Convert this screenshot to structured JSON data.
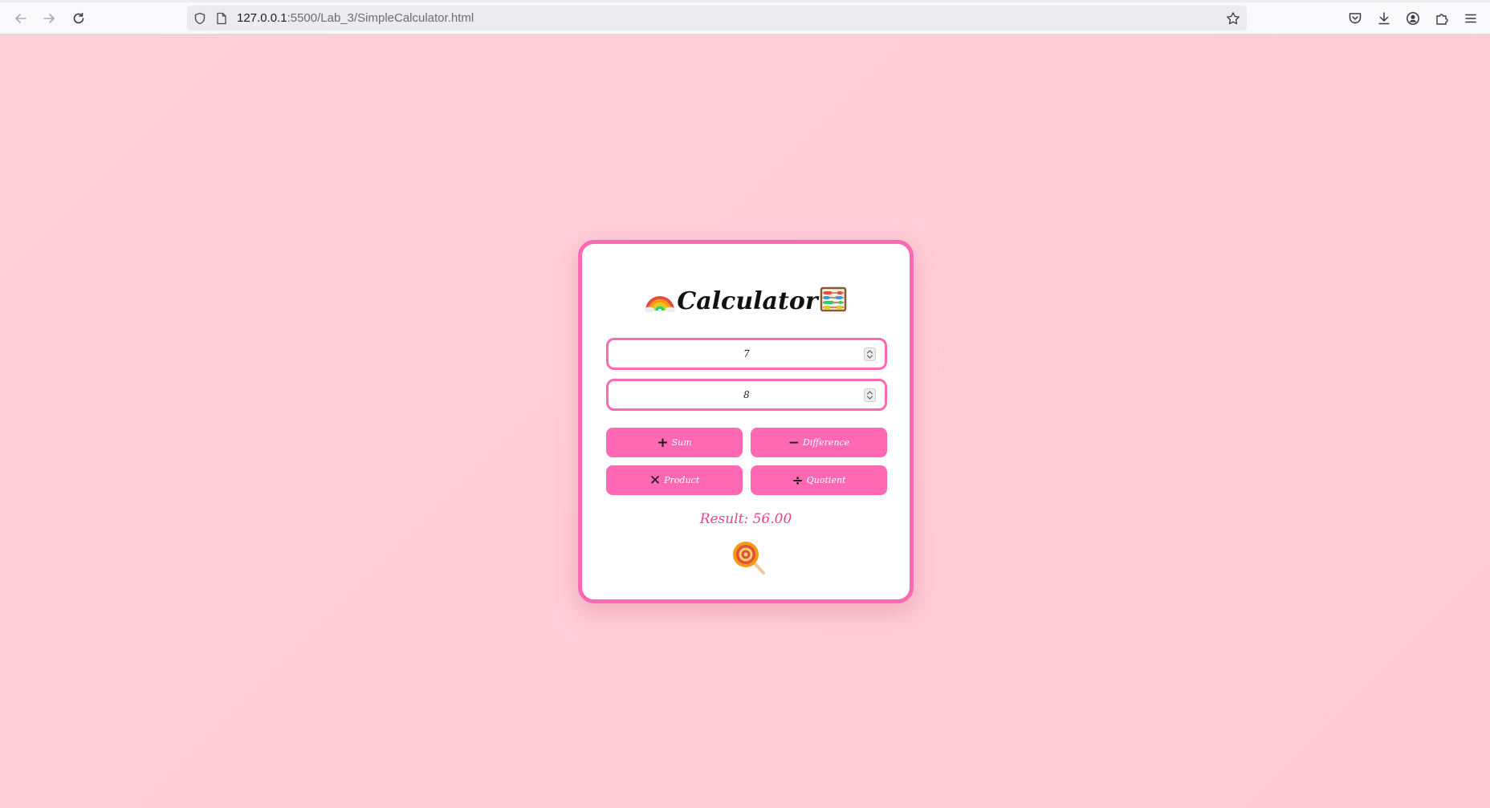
{
  "browser": {
    "url_host": "127.0.0.1",
    "url_rest": ":5500/Lab_3/SimpleCalculator.html"
  },
  "calculator": {
    "title": "Calculator",
    "title_left_icon": "rainbow-icon",
    "title_right_icon": "abacus-icon",
    "input1_value": "7",
    "input2_value": "8",
    "buttons": [
      {
        "symbol": "+",
        "label": "Sum"
      },
      {
        "symbol": "−",
        "label": "Difference"
      },
      {
        "symbol": "✕",
        "label": "Product"
      },
      {
        "symbol": "÷",
        "label": "Quotient"
      }
    ],
    "result": "Result: 56.00",
    "footer_icon": "lollipop-icon"
  },
  "colors": {
    "accent": "#ff69b4",
    "result_text": "#e0468f",
    "page_background": "#ffd0da"
  }
}
